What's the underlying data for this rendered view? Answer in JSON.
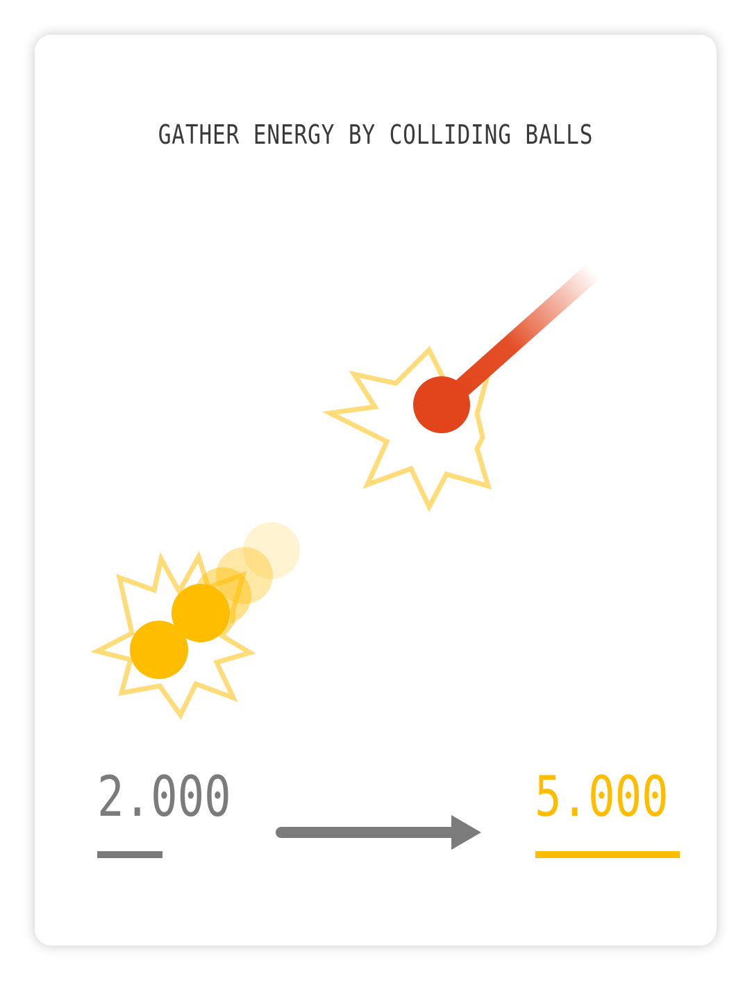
{
  "title": "GATHER ENERGY BY COLLIDING BALLS",
  "energy": {
    "from": "2.000",
    "to": "5.000"
  },
  "colors": {
    "text": "#3a3a3a",
    "gray": "#7b7b7b",
    "gold": "#ffbd00",
    "spark": "#ffdc7a",
    "red": "#e2451b"
  },
  "icons": {
    "arrow": "arrow-right-icon"
  }
}
